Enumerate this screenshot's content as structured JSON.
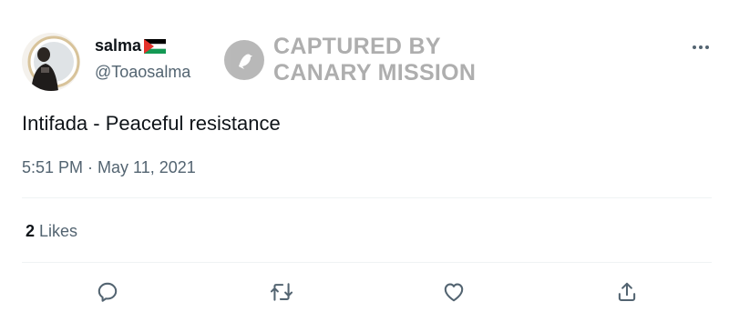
{
  "tweet": {
    "display_name": "salma",
    "flag_icon": "palestine-flag-icon",
    "handle": "@Toaosalma",
    "text": "Intifada - Peaceful resistance",
    "timestamp": "5:51 PM · May 11, 2021",
    "likes_count": "2",
    "likes_label": "Likes"
  },
  "watermark": {
    "line1": "CAPTURED BY",
    "line2": "CANARY MISSION"
  },
  "actions": {
    "reply_icon": "reply-icon",
    "retweet_icon": "retweet-icon",
    "like_icon": "heart-icon",
    "share_icon": "share-icon"
  },
  "colors": {
    "text_primary": "#0f1419",
    "text_secondary": "#536471",
    "divider": "#eff3f4"
  }
}
